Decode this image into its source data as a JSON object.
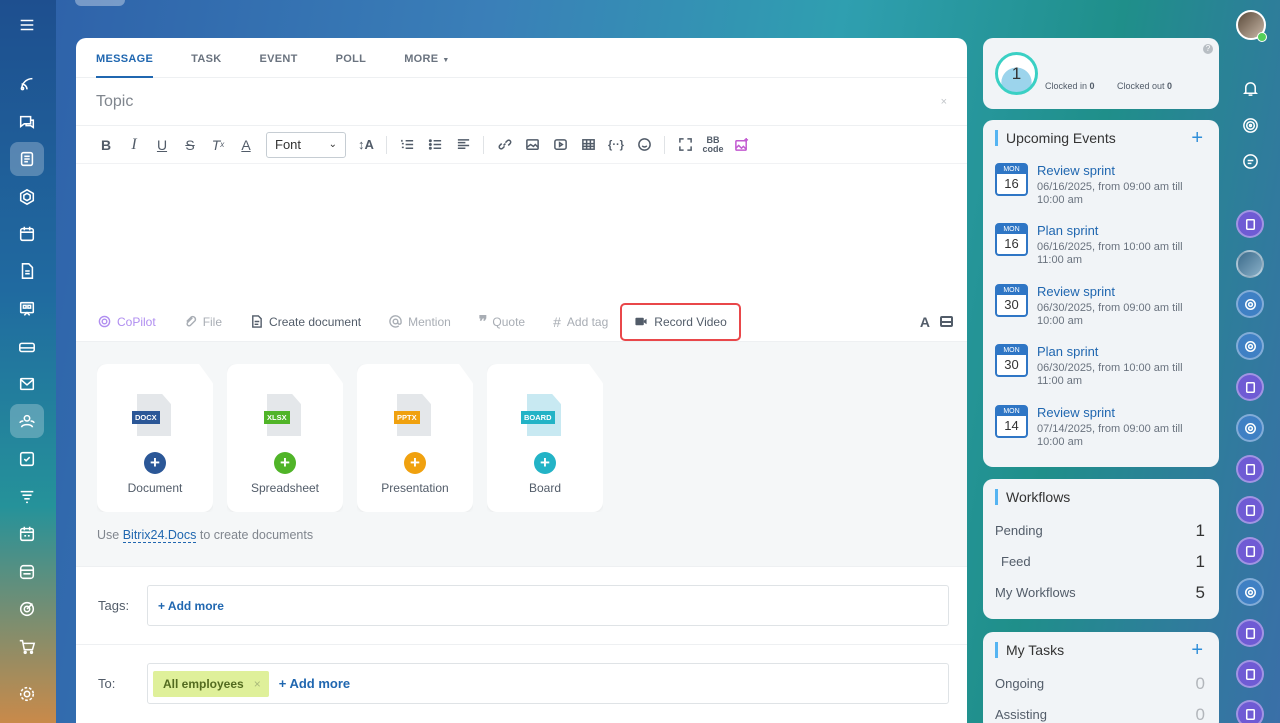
{
  "left_nav": {
    "items": [
      "menu",
      "feed",
      "chats",
      "tasks-docs",
      "workgroups",
      "calendar",
      "documents",
      "boards",
      "drive",
      "mail",
      "employees",
      "tasks",
      "crm",
      "sites",
      "store",
      "copilot",
      "market",
      "settings"
    ]
  },
  "composer": {
    "tabs": [
      {
        "label": "MESSAGE"
      },
      {
        "label": "TASK"
      },
      {
        "label": "EVENT"
      },
      {
        "label": "POLL"
      },
      {
        "label": "MORE"
      }
    ],
    "topic_placeholder": "Topic",
    "topic_close": "×",
    "font_select": "Font",
    "attach": {
      "copilot": "CoPilot",
      "file": "File",
      "create_document": "Create document",
      "mention": "Mention",
      "quote": "Quote",
      "add_tag": "Add tag",
      "record_video": "Record Video"
    },
    "documents": [
      {
        "tag": "DOCX",
        "label": "Document",
        "color": "#2b5797"
      },
      {
        "tag": "XLSX",
        "label": "Spreadsheet",
        "color": "#50b428"
      },
      {
        "tag": "PPTX",
        "label": "Presentation",
        "color": "#f0a10f"
      },
      {
        "tag": "BOARD",
        "label": "Board",
        "color": "#23b3c6"
      }
    ],
    "docs_note_prefix": "Use",
    "docs_link": "Bitrix24.Docs",
    "docs_note_suffix": "to create documents",
    "tags_label": "Tags:",
    "tags_add": "+ Add more",
    "to_label": "To:",
    "to_chip": "All employees",
    "to_chip_close": "×",
    "to_add": "+ Add more"
  },
  "timeman": {
    "count": "1",
    "clocked_in_label": "Clocked in",
    "clocked_in": "0",
    "clocked_out_label": "Clocked out",
    "clocked_out": "0",
    "help": "?"
  },
  "events": {
    "title": "Upcoming Events",
    "add": "+",
    "items": [
      {
        "month": "MON",
        "day": "16",
        "title": "Review sprint",
        "time": "06/16/2025, from 09:00 am till 10:00 am"
      },
      {
        "month": "MON",
        "day": "16",
        "title": "Plan sprint",
        "time": "06/16/2025, from 10:00 am till 11:00 am"
      },
      {
        "month": "MON",
        "day": "30",
        "title": "Review sprint",
        "time": "06/30/2025, from 09:00 am till 10:00 am"
      },
      {
        "month": "MON",
        "day": "30",
        "title": "Plan sprint",
        "time": "06/30/2025, from 10:00 am till 11:00 am"
      },
      {
        "month": "MON",
        "day": "14",
        "title": "Review sprint",
        "time": "07/14/2025, from 09:00 am till 10:00 am"
      }
    ]
  },
  "workflows": {
    "title": "Workflows",
    "rows": [
      {
        "label": "Pending",
        "value": "1"
      },
      {
        "label": "Feed",
        "value": "1"
      },
      {
        "label": "My Workflows",
        "value": "5"
      }
    ]
  },
  "my_tasks": {
    "title": "My Tasks",
    "add": "+",
    "rows": [
      {
        "label": "Ongoing",
        "value": "0"
      },
      {
        "label": "Assisting",
        "value": "0"
      }
    ]
  }
}
